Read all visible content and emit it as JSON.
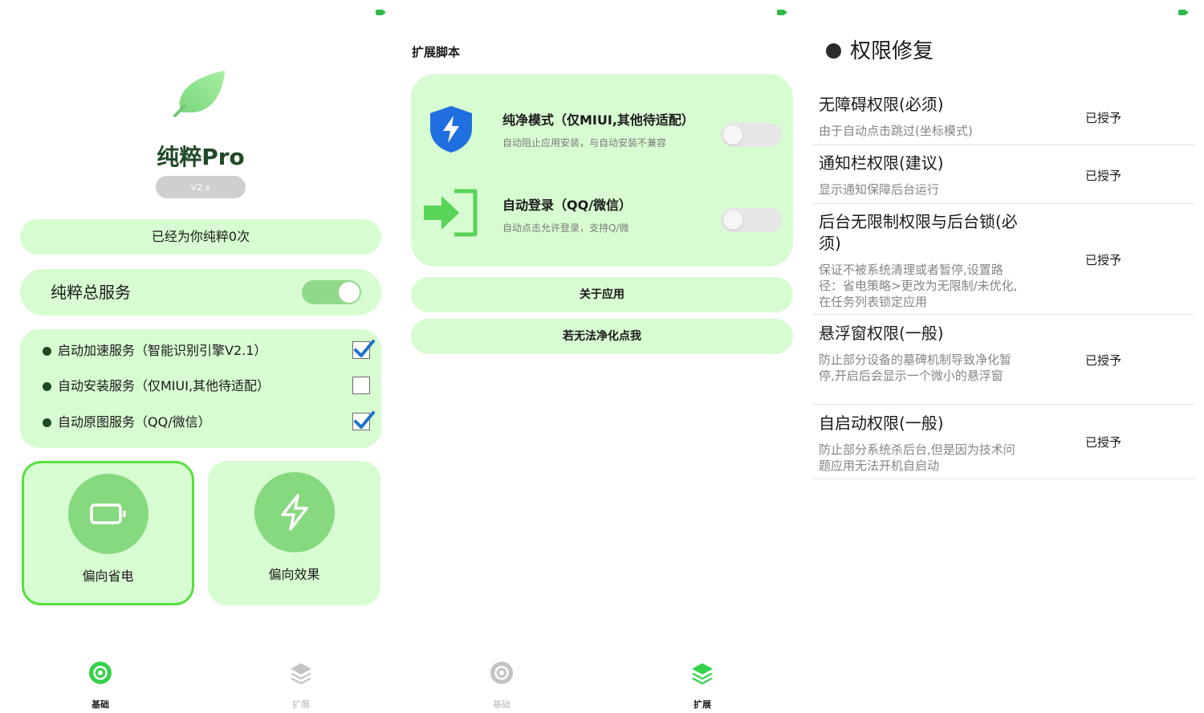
{
  "colors": {
    "card_bg": "#d8fcd2",
    "accent_green": "#55e03e",
    "circle_green": "#86d97e",
    "dark_green_text": "#1f4a26",
    "shield_blue": "#1f6fe0",
    "arrow_green": "#58d456"
  },
  "basic_page": {
    "app_name": "纯粹Pro",
    "version": "V2.x",
    "purify_count": "已经为你纯粹0次",
    "master_service": {
      "label": "纯粹总服务",
      "enabled": true
    },
    "options": [
      {
        "label": "启动加速服务（智能识别引擎V2.1）",
        "checked": true
      },
      {
        "label": "自动安装服务（仅MIUI,其他待适配）",
        "checked": false
      },
      {
        "label": "自动原图服务（QQ/微信）",
        "checked": true
      }
    ],
    "modes": [
      {
        "label": "偏向省电",
        "icon": "battery-icon",
        "selected": true
      },
      {
        "label": "偏向效果",
        "icon": "lightning-icon",
        "selected": false
      }
    ]
  },
  "extension_page": {
    "section_title": "扩展脚本",
    "scripts": [
      {
        "title": "纯净模式（仅MIUI,其他待适配）",
        "desc": "自动阻止应用安装，与自动安装不兼容",
        "icon": "shield-lightning-icon",
        "enabled": false
      },
      {
        "title": "自动登录（QQ/微信）",
        "desc": "自动点击允许登录，支持Q/微",
        "icon": "login-arrow-icon",
        "enabled": false
      }
    ],
    "about_button": "关于应用",
    "fail_button": "若无法净化点我"
  },
  "permission_page": {
    "title": "权限修复",
    "items": [
      {
        "title": "无障碍权限(必须)",
        "desc": "由于自动点击跳过(坐标模式)",
        "status": "已授予"
      },
      {
        "title": "通知栏权限(建议)",
        "desc": "显示通知保障后台运行",
        "status": "已授予"
      },
      {
        "title": "后台无限制权限与后台锁(必须)",
        "desc": "保证不被系统清理或者暂停,设置路径：省电策略>更改为无限制/未优化,在任务列表锁定应用",
        "status": "已授予"
      },
      {
        "title": "悬浮窗权限(一般)",
        "desc": "防止部分设备的墓碑机制导致净化暂停,开启后会显示一个微小的悬浮窗",
        "status": "已授予"
      },
      {
        "title": "自启动权限(一般)",
        "desc": "防止部分系统杀后台,但是因为技术问题应用无法开机自启动",
        "status": "已授予"
      }
    ]
  },
  "nav": {
    "basic_label": "基础",
    "extension_label": "扩展"
  }
}
